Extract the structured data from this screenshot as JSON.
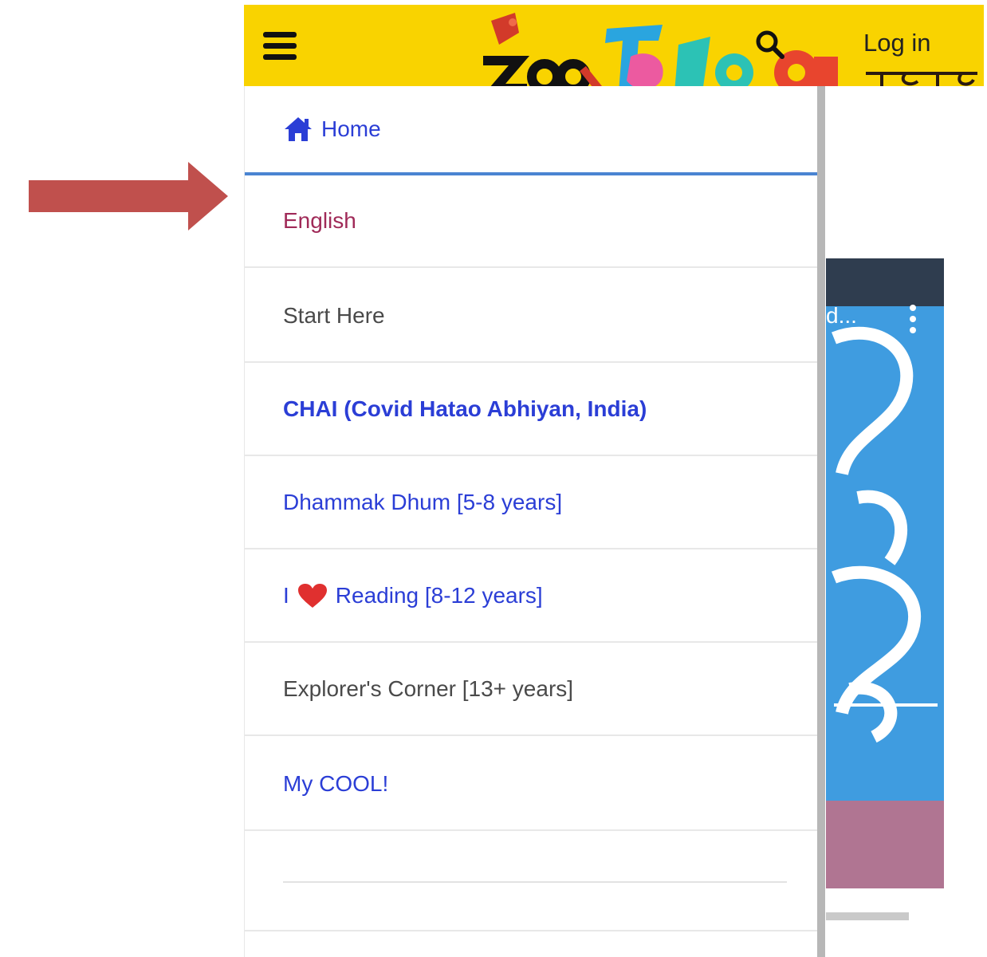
{
  "header": {
    "menu_icon": "hamburger-menu-icon",
    "search_icon": "search-icon",
    "login_label": "Log in",
    "background_color": "#f9d300"
  },
  "annotation": {
    "arrow_color": "#c0504d"
  },
  "drawer": {
    "items": [
      {
        "label": "Home",
        "icon": "home-icon",
        "color": "#2b3ed6"
      },
      {
        "label": "English",
        "color": "#a02a58"
      },
      {
        "label": "Start Here",
        "color": "#4a4a4a"
      },
      {
        "label": "CHAI (Covid Hatao Abhiyan, India)",
        "color": "#2b3ed6"
      },
      {
        "label": "Dhammak Dhum [5-8 years]",
        "color": "#2b3ed6"
      },
      {
        "label": "Reading [8-12 years]",
        "prefix": "I",
        "icon": "heart-icon",
        "color": "#2b3ed6"
      },
      {
        "label": "Explorer's Corner [13+ years]",
        "color": "#4a4a4a"
      },
      {
        "label": "My COOL!",
        "color": "#2b3ed6"
      }
    ],
    "active_indicator_color": "#4a84d2"
  },
  "background": {
    "video_title_fragment": "d...",
    "more_icon": "more-vertical-icon",
    "card_colors": [
      "#2f3d4f",
      "#3f9ce0",
      "#b07592"
    ]
  }
}
